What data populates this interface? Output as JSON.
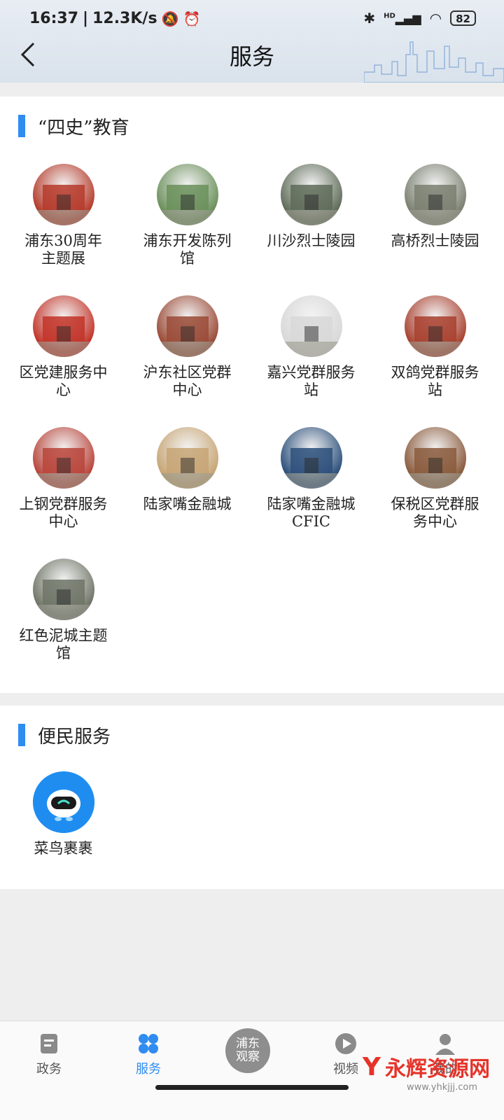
{
  "status_bar": {
    "time": "16:37",
    "net_speed": "12.3K/s",
    "battery": "82",
    "network": "HD"
  },
  "header": {
    "title": "服务"
  },
  "sections": [
    {
      "title": "“四史”教育",
      "items": [
        {
          "label": "浦东30周年主题展",
          "thumb": "exhibition-photo",
          "color": "#b53a2a"
        },
        {
          "label": "浦东开发陈列馆",
          "thumb": "building-photo",
          "color": "#6a8f5a"
        },
        {
          "label": "川沙烈士陵园",
          "thumb": "cemetery-photo",
          "color": "#5e6b58"
        },
        {
          "label": "高桥烈士陵园",
          "thumb": "memorial-photo",
          "color": "#7a7f70"
        },
        {
          "label": "区党建服务中心",
          "thumb": "hall-photo",
          "color": "#c23328"
        },
        {
          "label": "沪东社区党群中心",
          "thumb": "brick-building-photo",
          "color": "#9a4a36"
        },
        {
          "label": "嘉兴党群服务站",
          "thumb": "white-wall-photo",
          "color": "#d8d8d8"
        },
        {
          "label": "双鸽党群服务站",
          "thumb": "red-room-photo",
          "color": "#a8402e"
        },
        {
          "label": "上钢党群服务中心",
          "thumb": "red-facade-photo",
          "color": "#b8443a"
        },
        {
          "label": "陆家嘴金融城",
          "thumb": "lobby-photo",
          "color": "#c7a574"
        },
        {
          "label": "陆家嘴金融城CFIC",
          "thumb": "stage-photo",
          "color": "#2b4f7a"
        },
        {
          "label": "保税区党群服务中心",
          "thumb": "entrance-photo",
          "color": "#8a5a3c"
        },
        {
          "label": "红色泥城主题馆",
          "thumb": "gate-photo",
          "color": "#6d7466"
        }
      ]
    },
    {
      "title": "便民服务",
      "items": [
        {
          "label": "菜鸟裹裹",
          "thumb": "cainiao-logo",
          "color": "#1f8df0"
        }
      ]
    }
  ],
  "tabbar": {
    "tabs": [
      {
        "label": "政务",
        "icon": "document-icon"
      },
      {
        "label": "服务",
        "icon": "grid-icon",
        "active": true
      },
      {
        "label": "浦东观察",
        "icon": "logo"
      },
      {
        "label": "视频",
        "icon": "play-icon"
      },
      {
        "label": "我的",
        "icon": "user-icon"
      }
    ]
  },
  "watermark": {
    "brand": "永辉资源网",
    "url": "www.yhkjjj.com"
  }
}
